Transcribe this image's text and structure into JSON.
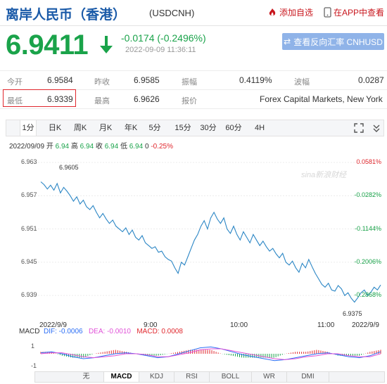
{
  "header": {
    "title": "离岸人民币（香港）",
    "code": "(USDCNH)",
    "add_favorite": "添加自选",
    "app_check": "在APP中查看"
  },
  "quote": {
    "price": "6.9411",
    "change": "-0.0174 (-0.2496%)",
    "time": "2022-09-09 11:36:11",
    "reverse_button": "查看反向汇率 CNHUSD"
  },
  "stats": {
    "row1": [
      {
        "label": "今开",
        "value": "6.9584"
      },
      {
        "label": "昨收",
        "value": "6.9585"
      },
      {
        "label": "振幅",
        "value": "0.4119%"
      },
      {
        "label": "波幅",
        "value": "0.0287"
      }
    ],
    "row2": [
      {
        "label": "最低",
        "value": "6.9339"
      },
      {
        "label": "最高",
        "value": "6.9626"
      },
      {
        "label": "报价",
        "value": "Forex Capital Markets, New York"
      }
    ]
  },
  "tabs": [
    "1分",
    "日K",
    "周K",
    "月K",
    "年K",
    "5分",
    "15分",
    "30分",
    "60分",
    "4H"
  ],
  "active_tab": "1分",
  "info_line": {
    "date": "2022/09/09",
    "open_label": "开",
    "open": "6.94",
    "high_label": "高",
    "high": "6.94",
    "close_label": "收",
    "close": "6.94",
    "low_label": "低",
    "low": "6.94",
    "vol": "0",
    "pct": "-0.25%"
  },
  "chart_data": {
    "type": "line",
    "ylim": [
      6.9375,
      6.9635
    ],
    "y_ticks": [
      "6.963",
      "6.957",
      "6.951",
      "6.945",
      "6.939"
    ],
    "y_tick_values": [
      6.963,
      6.957,
      6.951,
      6.945,
      6.939
    ],
    "pct_ticks": [
      "0.0581%",
      "-0.0282%",
      "-0.1144%",
      "-0.2006%",
      "-0.2868%"
    ],
    "x_ticks": [
      "2022/9/9",
      "9:00",
      "10:00",
      "11:00",
      "2022/9/9"
    ],
    "high_annotation": "6.9605",
    "low_annotation": "6.9375",
    "watermark": "sina新浪财经",
    "series": [
      {
        "values": [
          6.9595,
          6.959,
          6.9582,
          6.9589,
          6.958,
          6.9592,
          6.9575,
          6.9585,
          6.9578,
          6.957,
          6.956,
          6.9568,
          6.9555,
          6.9562,
          6.955,
          6.9545,
          6.9552,
          6.954,
          6.953,
          6.9538,
          6.9528,
          6.952,
          6.9526,
          6.9515,
          6.951,
          6.9505,
          6.9512,
          6.95,
          6.9508,
          6.9495,
          6.949,
          6.9498,
          6.9485,
          6.948,
          6.9475,
          6.9478,
          6.9468,
          6.947,
          6.946,
          6.9455,
          6.9452,
          6.944,
          6.943,
          6.945,
          6.9445,
          6.946,
          6.9475,
          6.949,
          6.95,
          6.9515,
          6.9525,
          6.951,
          6.953,
          6.954,
          6.9528,
          6.952,
          6.953,
          6.951,
          6.9502,
          6.9515,
          6.95,
          6.949,
          6.9505,
          6.9495,
          6.9485,
          6.95,
          6.949,
          6.948,
          6.9488,
          6.9478,
          6.947,
          6.9475,
          6.9465,
          6.9458,
          6.9466,
          6.945,
          6.9445,
          6.9452,
          6.944,
          6.9432,
          6.9448,
          6.944,
          6.9455,
          6.9442,
          6.943,
          6.942,
          6.941,
          6.9405,
          6.9412,
          6.94,
          6.9398,
          6.9408,
          6.9402,
          6.939,
          6.9395,
          6.9385,
          6.9378,
          6.9386,
          6.9395,
          6.94,
          6.939,
          6.9396,
          6.9405,
          6.94,
          6.9409
        ]
      }
    ]
  },
  "macd": {
    "label": "MACD",
    "dif": "DIF: -0.0006",
    "dea": "DEA: -0.0010",
    "macd": "MACD: 0.0008",
    "y_ticks": [
      "1",
      "-1"
    ],
    "dif_values": [
      0.1,
      0.2,
      0.0,
      -0.3,
      -0.5,
      -0.4,
      -0.2,
      0.0,
      0.1,
      0.0,
      -0.2,
      -0.4,
      -0.3,
      0.0,
      0.3,
      0.6,
      0.7,
      0.5,
      0.2,
      -0.1,
      -0.3,
      -0.5,
      -0.7,
      -0.6,
      -0.4,
      -0.2,
      0.0,
      0.1,
      -0.1,
      -0.3,
      -0.4,
      -0.2,
      0.2
    ],
    "dea_values": [
      0.0,
      0.1,
      0.1,
      -0.1,
      -0.3,
      -0.4,
      -0.3,
      -0.2,
      0.0,
      0.0,
      -0.1,
      -0.3,
      -0.3,
      -0.1,
      0.1,
      0.4,
      0.5,
      0.5,
      0.3,
      0.1,
      -0.1,
      -0.3,
      -0.5,
      -0.6,
      -0.5,
      -0.3,
      -0.2,
      0.0,
      0.0,
      -0.2,
      -0.3,
      -0.3,
      0.0
    ],
    "colors": {
      "dif": "#2b6ef5",
      "dea": "#e052d8",
      "up": "#e0272d",
      "down": "#1aa34a"
    }
  },
  "indicator_tabs": [
    "无",
    "MACD",
    "KDJ",
    "RSI",
    "BOLL",
    "WR",
    "DMI"
  ],
  "active_indicator": "MACD",
  "nav": {
    "prev": "◀",
    "next": "▶"
  },
  "colors": {
    "up": "#e0272d",
    "down": "#1aa34a",
    "line": "#2b86c5",
    "title": "#1a5aa8"
  }
}
